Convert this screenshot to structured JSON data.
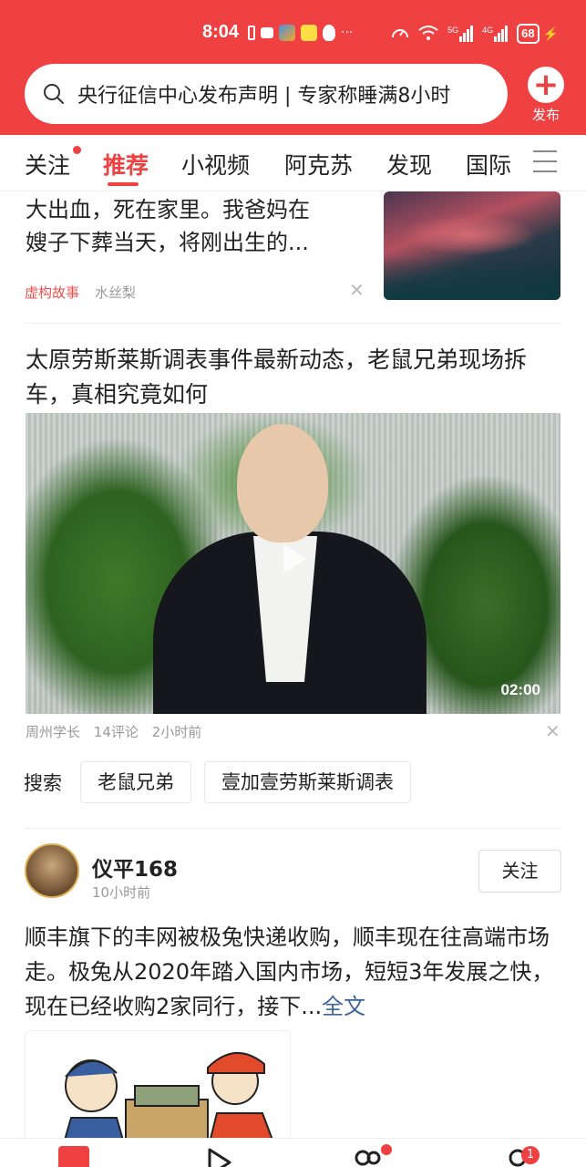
{
  "status_bar": {
    "time": "8:04",
    "battery": "68",
    "network_labels": [
      "5G",
      "4G"
    ]
  },
  "search": {
    "query": "央行征信中心发布声明 | 专家称睡满8小时"
  },
  "publish": {
    "label": "发布"
  },
  "tabs": [
    {
      "label": "关注",
      "has_dot": true
    },
    {
      "label": "推荐",
      "active": true
    },
    {
      "label": "小视频"
    },
    {
      "label": "阿克苏"
    },
    {
      "label": "发现"
    },
    {
      "label": "国际"
    }
  ],
  "article1": {
    "text_lines": [
      "大出血，死在家里。我爸妈在",
      "嫂子下葬当天，将刚出生的..."
    ],
    "tag": "虚构故事",
    "source": "水丝梨"
  },
  "article2": {
    "title": "太原劳斯莱斯调表事件最新动态，老鼠兄弟现场拆车，真相究竟如何",
    "duration": "02:00",
    "author": "周州学长",
    "comments": "14评论",
    "time": "2小时前"
  },
  "related_search": {
    "label": "搜索",
    "chips": [
      "老鼠兄弟",
      "壹加壹劳斯莱斯调表"
    ]
  },
  "post": {
    "author": "仪平168",
    "time": "10小时前",
    "follow_label": "关注",
    "text": "顺丰旗下的丰网被极兔快递收购，顺丰现在往高端市场走。极兔从2020年踏入国内市场，短短3年发展之快，现在已经收购2家同行，接下...",
    "more_label": "全文"
  },
  "bottom_nav": {
    "badge_count": "1"
  },
  "colors": {
    "brand_red": "#f04142",
    "link_blue": "#406599",
    "tag_red": "#e8524f"
  }
}
